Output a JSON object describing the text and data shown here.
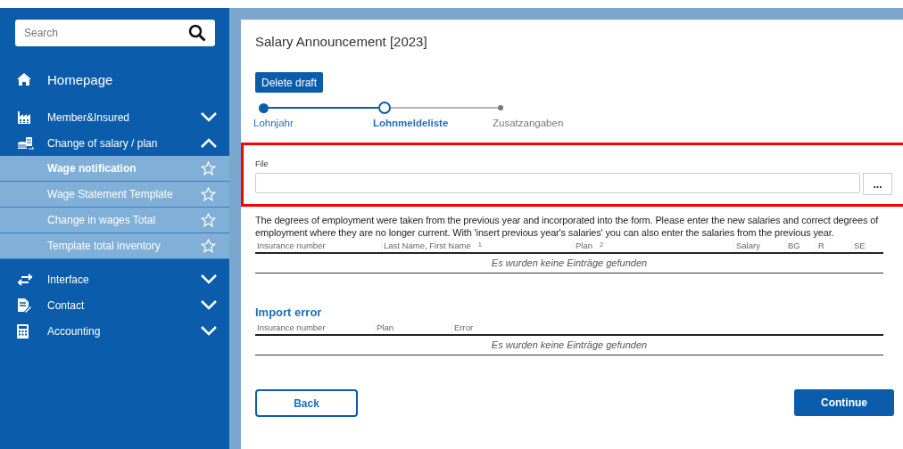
{
  "sidebar": {
    "search": {
      "placeholder": "Search"
    },
    "home": {
      "label": "Homepage"
    },
    "items": [
      {
        "label": "Member&Insured",
        "kind": "factory",
        "expanded": false
      },
      {
        "label": "Change of salary / plan",
        "kind": "coins",
        "expanded": true,
        "children": [
          {
            "label": "Wage notification",
            "selected": true
          },
          {
            "label": "Wage Statement Template",
            "selected": false
          },
          {
            "label": "Change in wages Total",
            "selected": false
          },
          {
            "label": "Template total inventory",
            "selected": false
          }
        ]
      },
      {
        "label": "Interface",
        "kind": "arrows",
        "expanded": false
      },
      {
        "label": "Contact",
        "kind": "document",
        "expanded": false
      },
      {
        "label": "Accounting",
        "kind": "calculator",
        "expanded": false
      }
    ]
  },
  "page": {
    "title": "Salary Announcement [2023]",
    "delete_button": "Delete draft",
    "stepper": {
      "steps": [
        {
          "label": "Lohnjahr",
          "done": true,
          "current": false
        },
        {
          "label": "Lohnmeldeliste",
          "done": false,
          "current": true
        },
        {
          "label": "Zusatzangaben",
          "done": false,
          "current": false
        }
      ]
    },
    "file_section": {
      "highlighted": true,
      "label": "File",
      "browse_button": "..."
    },
    "note": "The degrees of employment were taken from the previous year and incorporated into the form. Please enter the new salaries and correct degrees of employment where they are no longer current. With 'insert previous year's salaries' you can also enter the salaries from the previous year.",
    "table": {
      "columns": [
        {
          "label": "Insurance number"
        },
        {
          "label": "Last Name, First Name",
          "sort": "1"
        },
        {
          "label": "Plan",
          "sort": "2"
        },
        {
          "label": "Salary"
        },
        {
          "label": "BG"
        },
        {
          "label": "R"
        },
        {
          "label": "SE"
        }
      ],
      "empty_message": "Es wurden keine Einträge gefunden"
    },
    "import_error": {
      "title": "Import error",
      "columns": [
        {
          "label": "Insurance number"
        },
        {
          "label": "Plan"
        },
        {
          "label": "Error"
        }
      ],
      "empty_message": "Es wurden keine Einträge gefunden"
    },
    "buttons": {
      "back": "Back",
      "continue": "Continue"
    }
  }
}
